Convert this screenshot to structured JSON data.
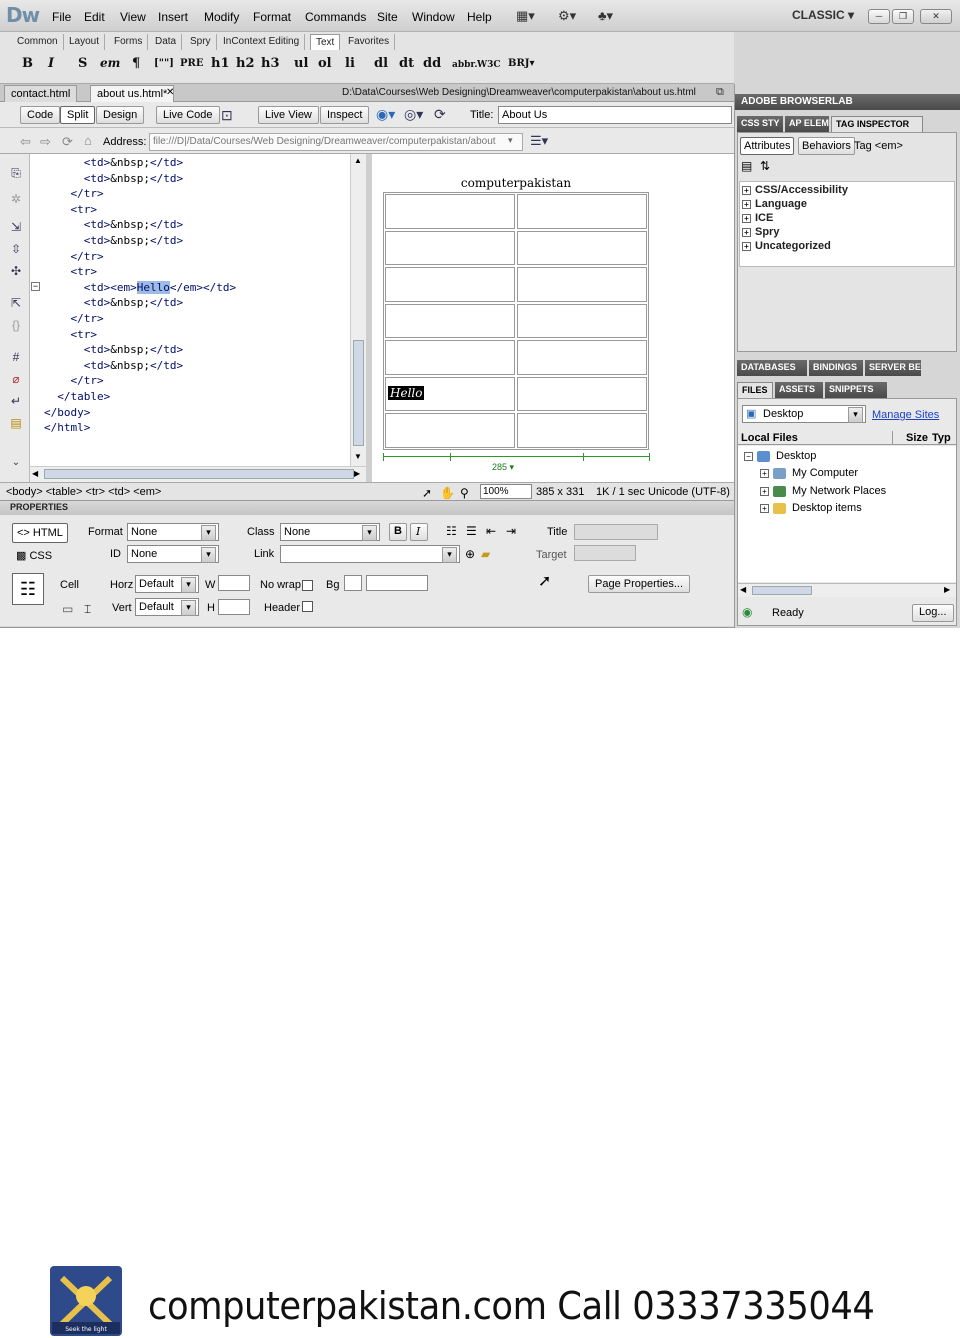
{
  "app": {
    "logo": "Dw",
    "workspace": "CLASSIC",
    "window_buttons": [
      "─",
      "❐",
      "✕"
    ]
  },
  "menu": [
    "File",
    "Edit",
    "View",
    "Insert",
    "Modify",
    "Format",
    "Commands",
    "Site",
    "Window",
    "Help"
  ],
  "insert_bar": {
    "categories": [
      "Common",
      "Layout",
      "Forms",
      "Data",
      "Spry",
      "InContext Editing",
      "Text",
      "Favorites"
    ],
    "active_category": "Text",
    "buttons": [
      "B",
      "I",
      "S",
      "em",
      "¶",
      "[\"\"]",
      "PRE",
      "h1",
      "h2",
      "h3",
      "ul",
      "ol",
      "li",
      "dl",
      "dt",
      "dd",
      "abbr.",
      "W3C",
      "BRJ"
    ]
  },
  "document_tabs": [
    {
      "label": "contact.html"
    },
    {
      "label": "about us.html*"
    }
  ],
  "document_path": "D:\\Data\\Courses\\Web Designing\\Dreamweaver\\computerpakistan\\about us.html",
  "doc_toolbar": {
    "code": "Code",
    "split": "Split",
    "design": "Design",
    "live_code": "Live Code",
    "live_view": "Live View",
    "inspect": "Inspect",
    "title_label": "Title:",
    "title_value": "About Us"
  },
  "address": {
    "label": "Address:",
    "value": "file:///D|/Data/Courses/Web Designing/Dreamweaver/computerpakistan/about"
  },
  "code_lines": [
    {
      "indent": "      ",
      "a": "<td>",
      "b": "&nbsp;",
      "c": "</td>"
    },
    {
      "indent": "      ",
      "a": "<td>",
      "b": "&nbsp;",
      "c": "</td>"
    },
    {
      "indent": "    ",
      "a": "</tr>",
      "b": "",
      "c": ""
    },
    {
      "indent": "    ",
      "a": "<tr>",
      "b": "",
      "c": ""
    },
    {
      "indent": "      ",
      "a": "<td>",
      "b": "&nbsp;",
      "c": "</td>"
    },
    {
      "indent": "      ",
      "a": "<td>",
      "b": "&nbsp;",
      "c": "</td>"
    },
    {
      "indent": "    ",
      "a": "</tr>",
      "b": "",
      "c": ""
    },
    {
      "indent": "    ",
      "a": "<tr>",
      "b": "",
      "c": ""
    },
    {
      "indent": "      ",
      "a": "<td><em>",
      "b": "Hello",
      "c": "</em></td>",
      "selected": true
    },
    {
      "indent": "      ",
      "a": "<td>",
      "b": "&nbsp;",
      "c": "</td>"
    },
    {
      "indent": "    ",
      "a": "</tr>",
      "b": "",
      "c": ""
    },
    {
      "indent": "    ",
      "a": "<tr>",
      "b": "",
      "c": ""
    },
    {
      "indent": "      ",
      "a": "<td>",
      "b": "&nbsp;",
      "c": "</td>"
    },
    {
      "indent": "      ",
      "a": "<td>",
      "b": "&nbsp;",
      "c": "</td>"
    },
    {
      "indent": "    ",
      "a": "</tr>",
      "b": "",
      "c": ""
    },
    {
      "indent": "  ",
      "a": "</table>",
      "b": "",
      "c": ""
    },
    {
      "indent": "",
      "a": "</body>",
      "b": "",
      "c": ""
    },
    {
      "indent": "",
      "a": "</html>",
      "b": "",
      "c": ""
    }
  ],
  "design": {
    "caption": "computerpakistan",
    "hello": "Hello",
    "table_width": "285",
    "rows": 7,
    "cols": 2,
    "hello_row": 5
  },
  "status": {
    "tag_selector": "<body> <table> <tr> <td> <em>",
    "zoom": "100%",
    "dimensions": "385 x 331",
    "size": "1K / 1 sec",
    "encoding": "Unicode (UTF-8)"
  },
  "properties": {
    "header": "PROPERTIES",
    "html_tab": "HTML",
    "css_tab": "CSS",
    "format_label": "Format",
    "format_value": "None",
    "id_label": "ID",
    "id_value": "None",
    "class_label": "Class",
    "class_value": "None",
    "link_label": "Link",
    "title_label": "Title",
    "target_label": "Target",
    "cell_label": "Cell",
    "horz_label": "Horz",
    "horz_value": "Default",
    "vert_label": "Vert",
    "vert_value": "Default",
    "w_label": "W",
    "h_label": "H",
    "nowrap_label": "No wrap",
    "bg_label": "Bg",
    "header_label": "Header",
    "page_properties": "Page Properties..."
  },
  "panels": {
    "browserlab": "ADOBE BROWSERLAB",
    "top_tabs": [
      "CSS STY",
      "AP ELEM",
      "TAG INSPECTOR"
    ],
    "attr_tab": "Attributes",
    "behaviors_tab": "Behaviors",
    "tag_label": "Tag <em>",
    "categories": [
      "CSS/Accessibility",
      "Language",
      "ICE",
      "Spry",
      "Uncategorized"
    ],
    "mid_tabs": [
      "DATABASES",
      "BINDINGS",
      "SERVER BE"
    ],
    "files_tabs": [
      "FILES",
      "ASSETS",
      "SNIPPETS"
    ],
    "site_select": "Desktop",
    "manage_sites": "Manage Sites",
    "col_local": "Local Files",
    "col_size": "Size",
    "col_type": "Typ",
    "tree": [
      {
        "label": "Desktop",
        "level": 0
      },
      {
        "label": "My Computer",
        "level": 1
      },
      {
        "label": "My Network Places",
        "level": 1
      },
      {
        "label": "Desktop items",
        "level": 1
      }
    ],
    "status": "Ready",
    "log": "Log..."
  },
  "banner": {
    "text": "computerpakistan.com   Call 03337335044",
    "emblem_motto": "Seek the light"
  },
  "colors": {
    "selection": "#9ebbe6",
    "code_tag": "#000d6b",
    "width_guide": "#2a9a2a",
    "link": "#1a3ec8"
  }
}
